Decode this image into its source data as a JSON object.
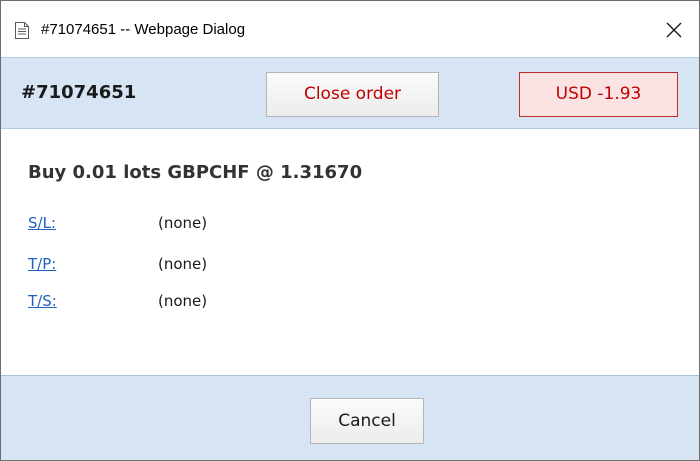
{
  "window": {
    "title": "#71074651 -- Webpage Dialog",
    "icons": {
      "title": "document-icon",
      "close": "close-icon"
    }
  },
  "header": {
    "order_id": "#71074651",
    "close_order_label": "Close order",
    "pnl": "USD -1.93"
  },
  "order": {
    "summary": "Buy 0.01 lots GBPCHF @ 1.31670",
    "params": [
      {
        "label": "S/L:",
        "value": "(none)"
      },
      {
        "label": "T/P:",
        "value": "(none)"
      },
      {
        "label": "T/S:",
        "value": "(none)"
      }
    ]
  },
  "footer": {
    "cancel_label": "Cancel"
  },
  "colors": {
    "band_background": "#d6e4f3",
    "danger_text": "#c00000",
    "pnl_background": "#fbe3e3",
    "link": "#1f5fbf"
  }
}
